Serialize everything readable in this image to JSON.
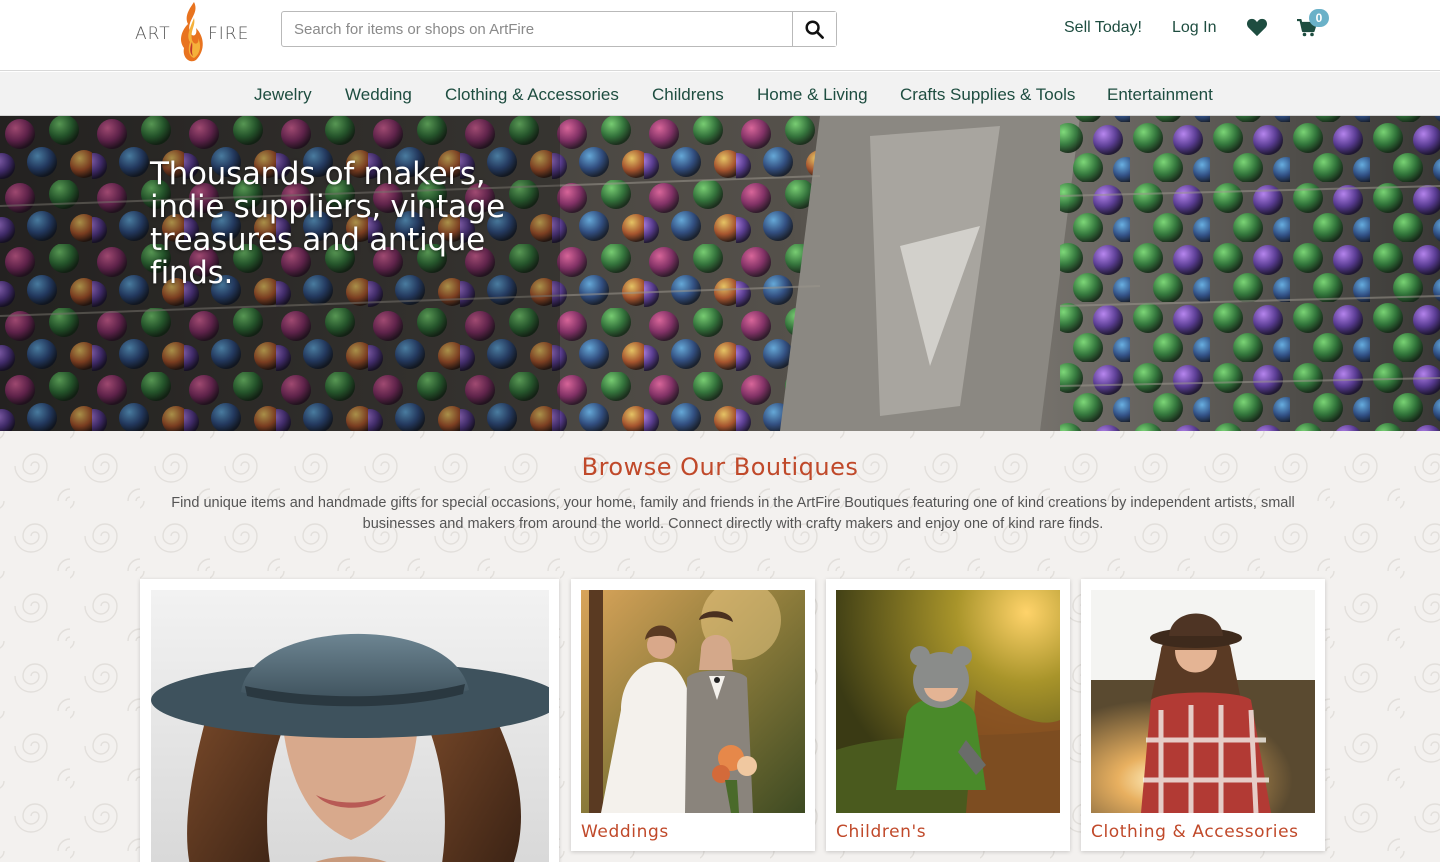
{
  "brand": {
    "art": "ART",
    "fire": "FIRE"
  },
  "search": {
    "placeholder": "Search for items or shops on ArtFire"
  },
  "top_links": {
    "sell": "Sell Today!",
    "login": "Log In"
  },
  "cart": {
    "count": "0"
  },
  "icons": {
    "search": "search-icon",
    "heart": "heart-icon",
    "cart": "cart-icon"
  },
  "colors": {
    "brand_green": "#1e4d40",
    "accent_orange": "#c0492a",
    "badge_blue": "#6ab1c8"
  },
  "nav": {
    "items": [
      {
        "label": "Jewelry"
      },
      {
        "label": "Wedding"
      },
      {
        "label": "Clothing & Accessories"
      },
      {
        "label": "Childrens"
      },
      {
        "label": "Home & Living"
      },
      {
        "label": "Crafts Supplies & Tools"
      },
      {
        "label": "Entertainment"
      }
    ]
  },
  "hero": {
    "headline": "Thousands of makers, indie suppliers, vintage treasures and antique finds."
  },
  "boutiques": {
    "title": "Browse Our Boutiques",
    "description": "Find unique items and handmade gifts for special occasions, your home, family and friends in the ArtFire Boutiques featuring one of kind creations by independent artists, small businesses and makers from around the world. Connect directly with crafty makers and enjoy one of kind rare finds.",
    "cards": [
      {
        "label": ""
      },
      {
        "label": "Weddings"
      },
      {
        "label": "Children's"
      },
      {
        "label": "Clothing & Accessories"
      }
    ]
  }
}
